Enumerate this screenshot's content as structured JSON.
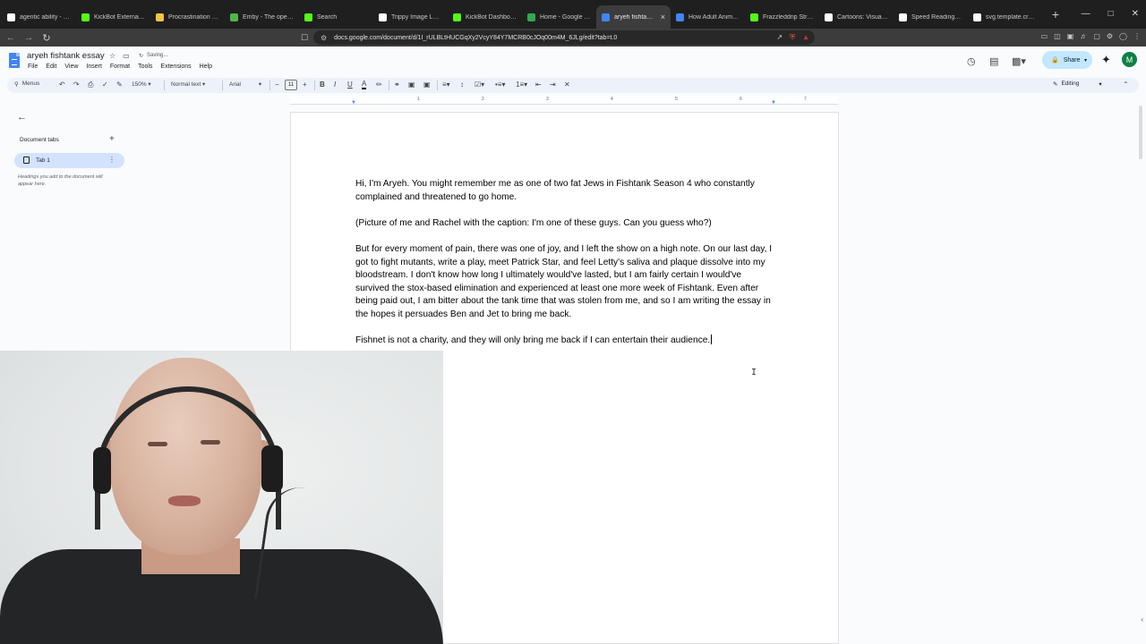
{
  "browser": {
    "tabs": [
      {
        "title": "agentic ability - Goo",
        "color": "#ffffff"
      },
      {
        "title": "KickBot External Widg",
        "color": "#53fc18"
      },
      {
        "title": "Procrastination | Ency",
        "color": "#f4c542"
      },
      {
        "title": "Emby - The open med",
        "color": "#52b54b"
      },
      {
        "title": "Search",
        "color": "#53fc18"
      },
      {
        "title": "Trippy Image Layering",
        "color": "#ffffff"
      },
      {
        "title": "KickBot Dashboard",
        "color": "#53fc18"
      },
      {
        "title": "Home - Google Drive",
        "color": "#34a853"
      },
      {
        "title": "aryeh fishtank ess",
        "color": "#4285f4"
      },
      {
        "title": "How Adult Animation",
        "color": "#4285f4"
      },
      {
        "title": "Frazzleddrip Stream",
        "color": "#53fc18"
      },
      {
        "title": "Cartoons: Visual Hum",
        "color": "#ffffff"
      },
      {
        "title": "Speed Reading, Listen",
        "color": "#ffffff"
      },
      {
        "title": "svg.template.creately",
        "color": "#ffffff"
      }
    ],
    "active_tab_index": 8,
    "url": "docs.google.com/document/d/1I_rULBLtHUCGqXy2VcyY84Y7MCRB0cJOq00m4M_6JLg/edit?tab=t.0"
  },
  "docs": {
    "title": "aryeh fishtank essay",
    "save_status": "Saving...",
    "menu": [
      "File",
      "Edit",
      "View",
      "Insert",
      "Format",
      "Tools",
      "Extensions",
      "Help"
    ],
    "share_label": "Share",
    "avatar_letter": "M",
    "toolbar": {
      "menus_label": "Menus",
      "zoom": "150%",
      "style": "Normal text",
      "font": "Arial",
      "font_size": "11",
      "mode": "Editing"
    },
    "ruler_numbers": [
      "1",
      "2",
      "3",
      "4",
      "5",
      "6",
      "7"
    ],
    "sidebar": {
      "heading": "Document tabs",
      "tab_label": "Tab 1",
      "hint": "Headings you add to the document will appear here."
    },
    "body": {
      "p1": "Hi, I'm Aryeh. You might remember me as one of two fat Jews in Fishtank Season 4 who constantly complained and threatened to go home.",
      "p2": "(Picture of me and Rachel with the caption: I'm one of these guys. Can you guess who?)",
      "p3": "But for every moment of pain, there was one of joy, and I left the show on a high note. On our last day, I got to fight mutants, write a play, meet Patrick Star, and feel Letty's saliva and plaque dissolve into my bloodstream. I don't know how long I ultimately would've lasted, but I am fairly certain I would've survived the stox-based elimination and experienced at least one more week of Fishtank.  Even after being paid out, I am bitter about the tank time that was stolen from me, and so I am writing the essay in the hopes it persuades Ben and Jet to bring me back.",
      "p4": "Fishnet is not a charity, and they will only bring me back if I can entertain their audience."
    }
  }
}
